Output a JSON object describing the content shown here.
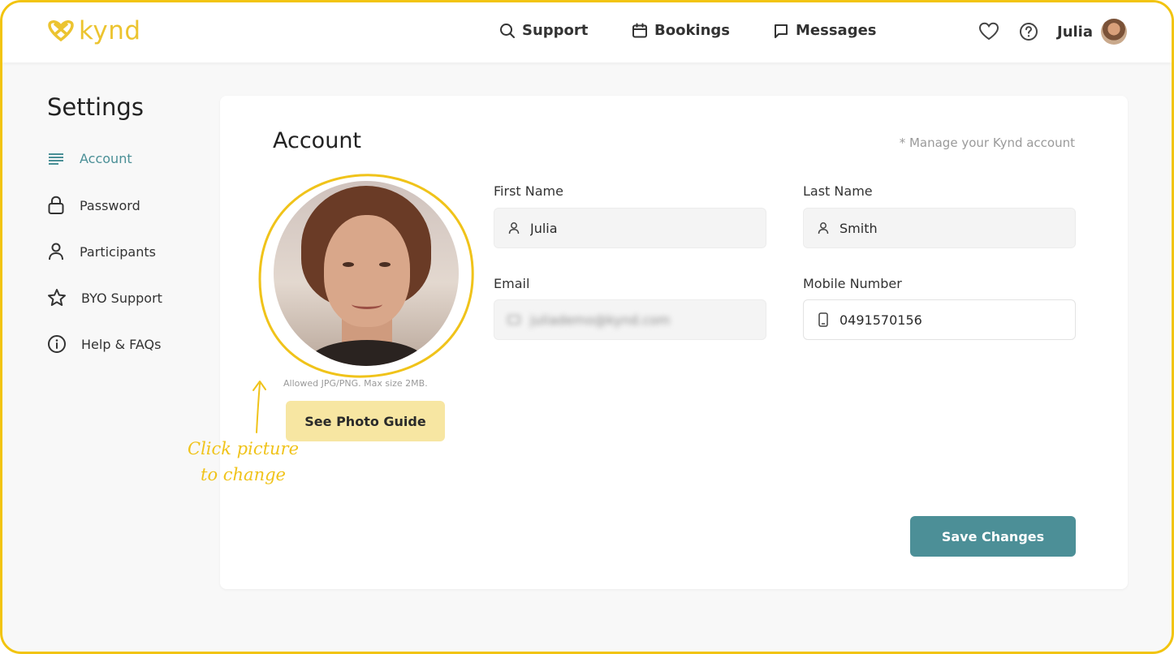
{
  "app": {
    "brand": "kynd"
  },
  "colors": {
    "accent_yellow": "#ecc430",
    "accent_teal": "#4c8f97",
    "frame_border": "#f2c40f",
    "button_light": "#f7e6a2"
  },
  "header": {
    "nav": [
      {
        "label": "Support",
        "icon": "search-icon"
      },
      {
        "label": "Bookings",
        "icon": "calendar-icon"
      },
      {
        "label": "Messages",
        "icon": "chat-icon"
      }
    ],
    "icons": [
      "heart-icon",
      "help-icon"
    ],
    "user": {
      "name": "Julia"
    }
  },
  "sidebar": {
    "title": "Settings",
    "items": [
      {
        "label": "Account",
        "icon": "menu-lines-icon",
        "active": true
      },
      {
        "label": "Password",
        "icon": "lock-icon",
        "active": false
      },
      {
        "label": "Participants",
        "icon": "user-icon",
        "active": false
      },
      {
        "label": "BYO Support",
        "icon": "star-icon",
        "active": false
      },
      {
        "label": "Help & FAQs",
        "icon": "info-icon",
        "active": false
      }
    ]
  },
  "account": {
    "title": "Account",
    "note": "* Manage your Kynd account",
    "photo_hint": "Allowed JPG/PNG. Max size 2MB.",
    "photo_guide_label": "See Photo Guide",
    "fields": {
      "first_name": {
        "label": "First Name",
        "value": "Julia"
      },
      "last_name": {
        "label": "Last Name",
        "value": "Smith"
      },
      "email": {
        "label": "Email",
        "value": "juliademo@kynd.com"
      },
      "mobile": {
        "label": "Mobile Number",
        "value": "0491570156"
      }
    },
    "save_label": "Save Changes"
  },
  "annotation": {
    "line1": "Click picture",
    "line2": "to change"
  }
}
